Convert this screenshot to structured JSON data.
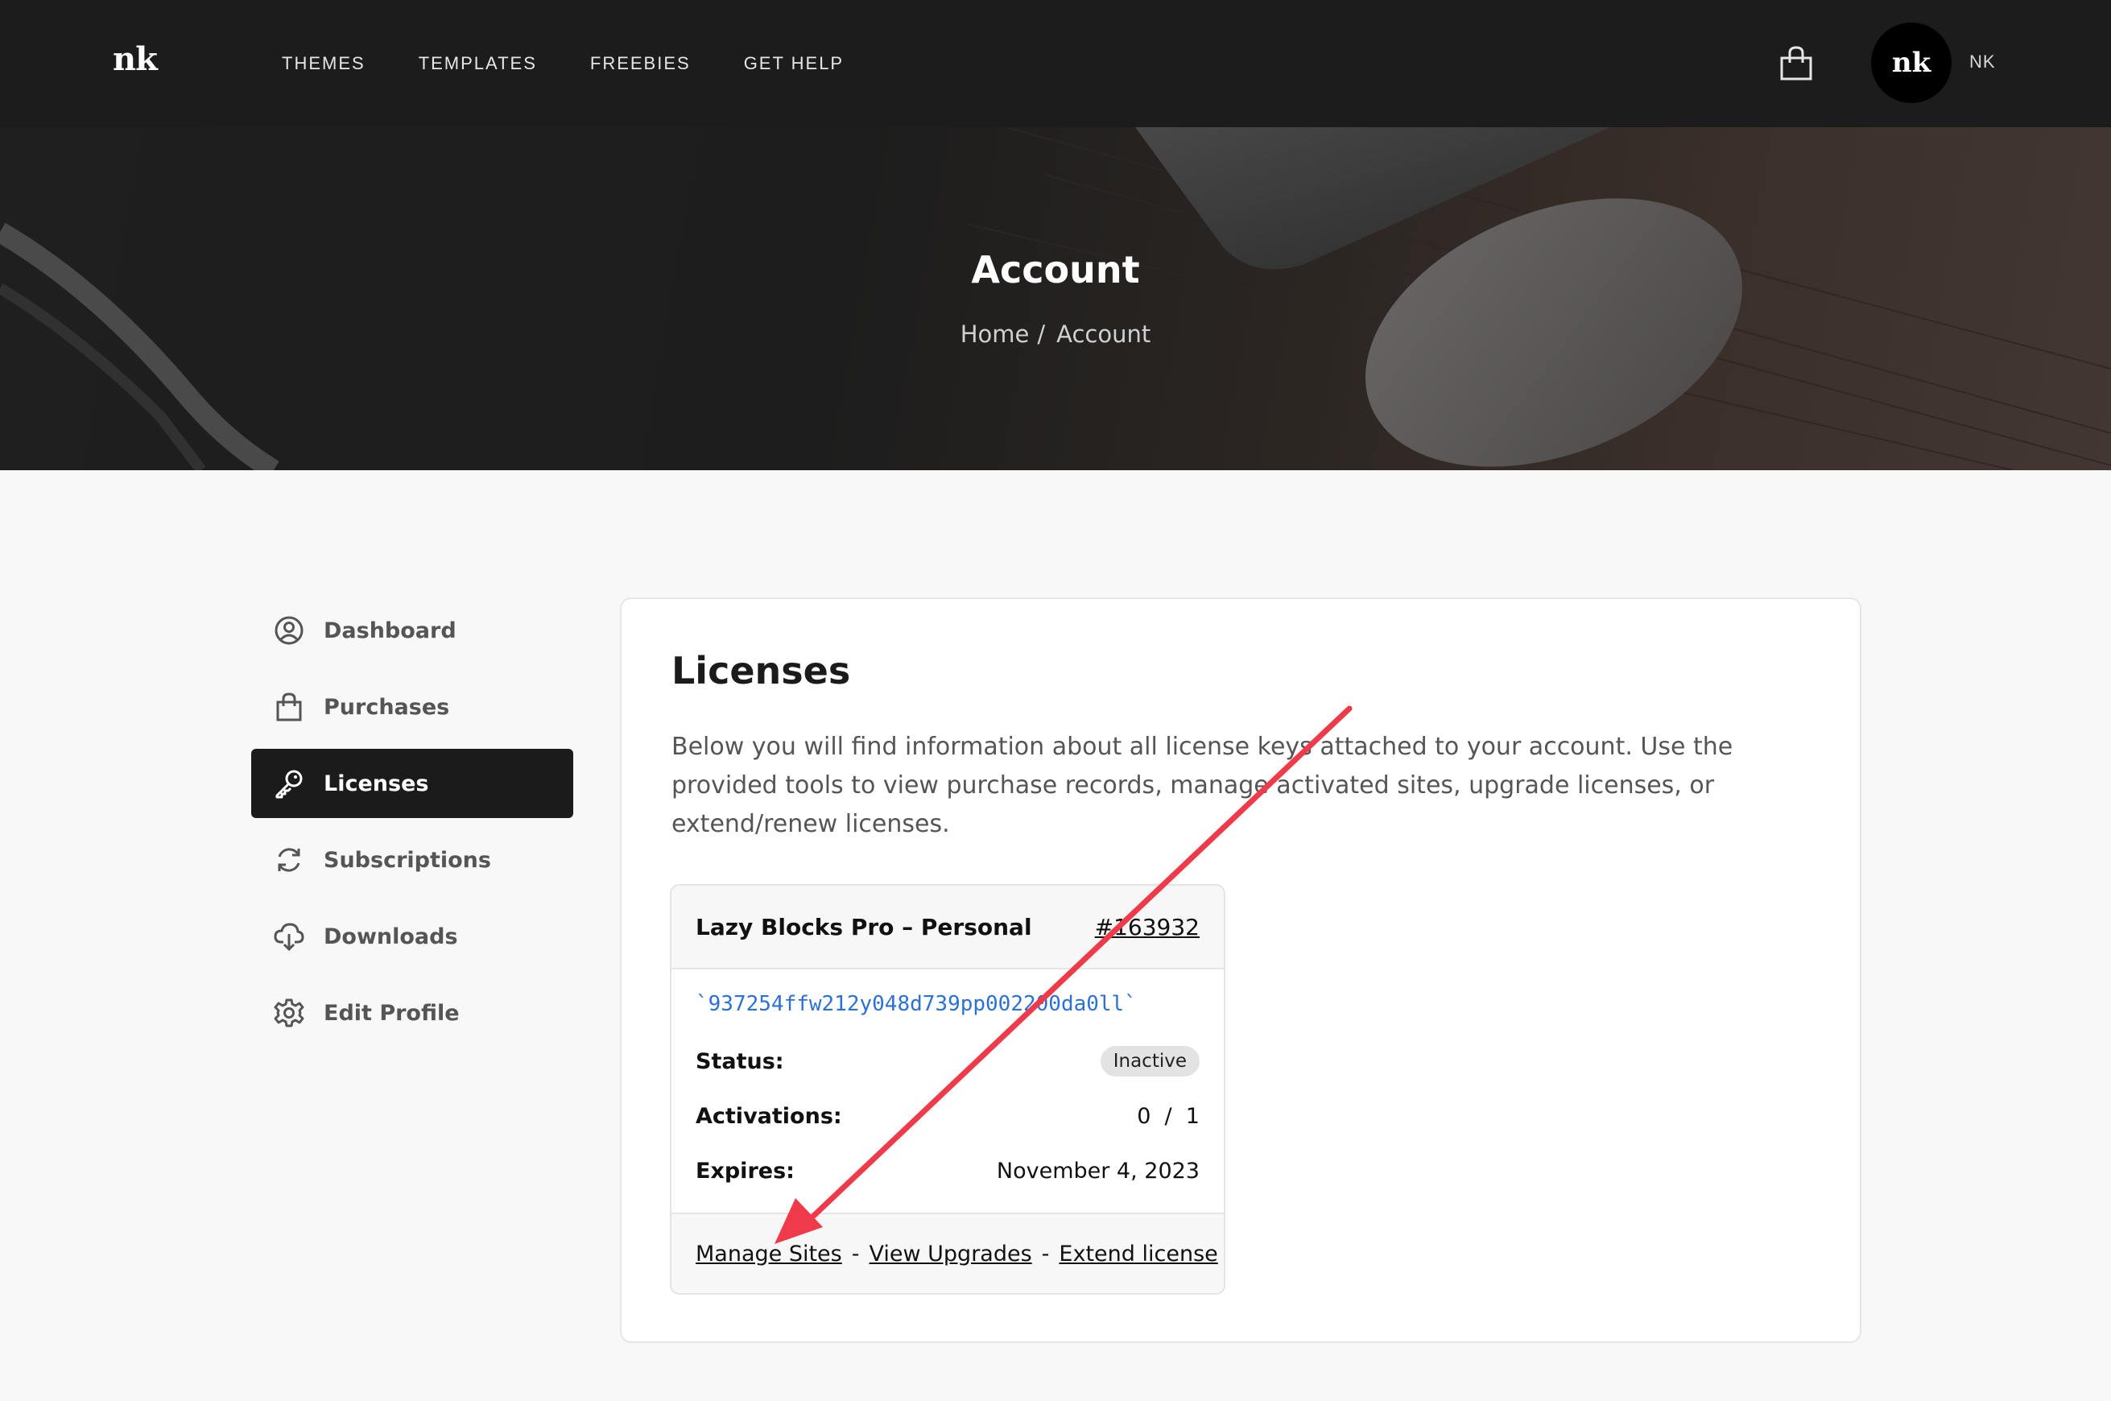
{
  "header": {
    "logo": "nk",
    "nav": [
      "THEMES",
      "TEMPLATES",
      "FREEBIES",
      "GET HELP"
    ],
    "avatar_text": "nk",
    "user_initials": "NK",
    "cart_icon": "shopping-bag-icon"
  },
  "hero": {
    "title": "Account",
    "breadcrumb": [
      "Home",
      "Account"
    ],
    "breadcrumb_separator": "/"
  },
  "sidebar": {
    "items": [
      {
        "label": "Dashboard",
        "icon": "user-circle-icon",
        "active": false
      },
      {
        "label": "Purchases",
        "icon": "shopping-bag-icon",
        "active": false
      },
      {
        "label": "Licenses",
        "icon": "key-icon",
        "active": true
      },
      {
        "label": "Subscriptions",
        "icon": "refresh-icon",
        "active": false
      },
      {
        "label": "Downloads",
        "icon": "cloud-download-icon",
        "active": false
      },
      {
        "label": "Edit Profile",
        "icon": "gear-icon",
        "active": false
      }
    ]
  },
  "main": {
    "title": "Licenses",
    "description": "Below you will find information about all license keys attached to your account. Use the provided tools to view purchase records, manage activated sites, upgrade licenses, or extend/renew licenses.",
    "license": {
      "name": "Lazy Blocks Pro – Personal",
      "id": "#163932",
      "key": "`937254ffw212y048d739pp002200da0ll`",
      "status_label": "Status:",
      "status_value": "Inactive",
      "activations_label": "Activations:",
      "activations_value": "0  /  1",
      "expires_label": "Expires:",
      "expires_value": "November 4, 2023",
      "actions": [
        "Manage Sites",
        "View Upgrades",
        "Extend license"
      ],
      "action_separator": "-"
    }
  },
  "colors": {
    "accent_link": "#2b71d6",
    "annotation_arrow": "#ef3a4a",
    "dark": "#1b1b1b"
  }
}
